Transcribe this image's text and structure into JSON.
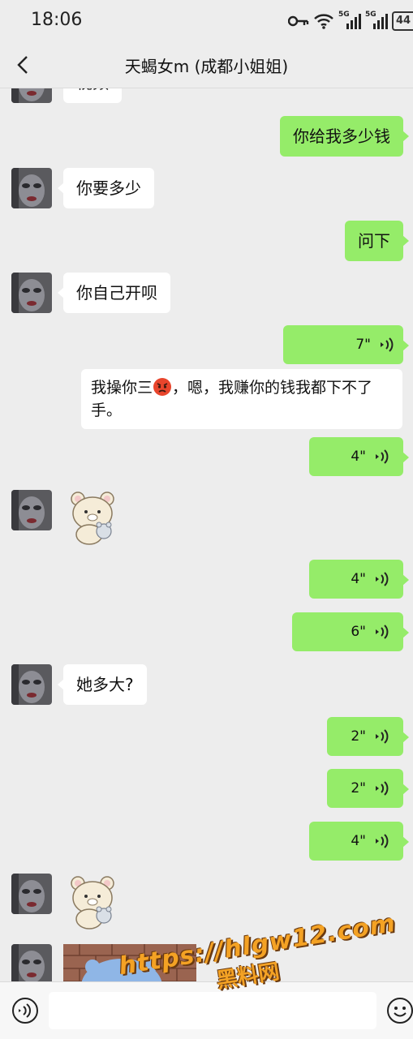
{
  "status_bar": {
    "time": "18:06",
    "battery": "44",
    "signal1": "5G",
    "signal2": "5G"
  },
  "header": {
    "title": "天蝎女m (成都小姐姐)"
  },
  "messages": [
    {
      "side": "in",
      "type": "text",
      "text": "视频"
    },
    {
      "side": "out",
      "type": "text",
      "text": "你给我多少钱"
    },
    {
      "side": "in",
      "type": "text",
      "text": "你要多少"
    },
    {
      "side": "out",
      "type": "text",
      "text": "问下"
    },
    {
      "side": "in",
      "type": "text",
      "text": "你自己开呗"
    },
    {
      "side": "out",
      "type": "voice",
      "duration": "7\""
    },
    {
      "side": "out",
      "type": "voice_transcript",
      "text_before": "我操你三",
      "emoji": "angry-face-icon",
      "text_after": "，嗯，我赚你的钱我都下不了手。"
    },
    {
      "side": "out",
      "type": "voice",
      "duration": "4\""
    },
    {
      "side": "in",
      "type": "sticker",
      "sticker": "bear-sticker"
    },
    {
      "side": "out",
      "type": "voice",
      "duration": "4\""
    },
    {
      "side": "out",
      "type": "voice",
      "duration": "6\""
    },
    {
      "side": "in",
      "type": "text",
      "text": "她多大?"
    },
    {
      "side": "out",
      "type": "voice",
      "duration": "2\""
    },
    {
      "side": "out",
      "type": "voice",
      "duration": "2\""
    },
    {
      "side": "out",
      "type": "voice",
      "duration": "4\""
    },
    {
      "side": "in",
      "type": "sticker",
      "sticker": "bear-sticker"
    },
    {
      "side": "in",
      "type": "image",
      "image": "photo-thumbnail"
    }
  ],
  "input": {
    "value": ""
  },
  "watermark": {
    "url": "https://hlgw12.com",
    "text": "黑料网"
  },
  "colors": {
    "background": "#ededed",
    "bubble_out": "#95ec69",
    "bubble_in": "#ffffff",
    "watermark": "#f4a224"
  }
}
